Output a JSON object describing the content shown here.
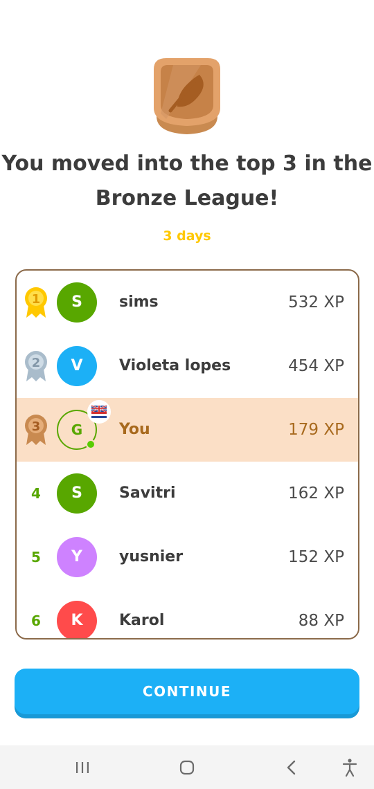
{
  "headline_line1": "You moved into the top 3 in the",
  "headline_line2": "Bronze League!",
  "days_left": "3 days",
  "league": {
    "badge_icon": "bronze-league-feather-icon",
    "color": "#d99a5b"
  },
  "leaderboard": [
    {
      "rank": "1",
      "medal": "gold",
      "initial": "S",
      "name": "sims",
      "xp": "532 XP",
      "avatar_color": "#58a700"
    },
    {
      "rank": "2",
      "medal": "silver",
      "initial": "V",
      "name": "Violeta lopes",
      "xp": "454 XP",
      "avatar_color": "#1cb0f6"
    },
    {
      "rank": "3",
      "medal": "bronze",
      "initial": "G",
      "name": "You",
      "xp": "179 XP",
      "avatar_color": "#58a700",
      "is_current_user": true,
      "flag_icon": "uk-flag-icon"
    },
    {
      "rank": "4",
      "initial": "S",
      "name": "Savitri",
      "xp": "162 XP",
      "avatar_color": "#58a700"
    },
    {
      "rank": "5",
      "initial": "Y",
      "name": "yusnier",
      "xp": "152 XP",
      "avatar_color": "#ce82ff"
    },
    {
      "rank": "6",
      "initial": "K",
      "name": "Karol",
      "xp": "88 XP",
      "avatar_color": "#ff4b4b"
    }
  ],
  "continue_label": "CONTINUE",
  "colors": {
    "accent": "#1cb0f6",
    "highlight_row": "#fbdfc6",
    "days": "#ffc800",
    "rank_number": "#58a700"
  },
  "navbar": {
    "items": [
      "recent-apps-icon",
      "home-icon",
      "back-icon",
      "accessibility-icon"
    ]
  }
}
